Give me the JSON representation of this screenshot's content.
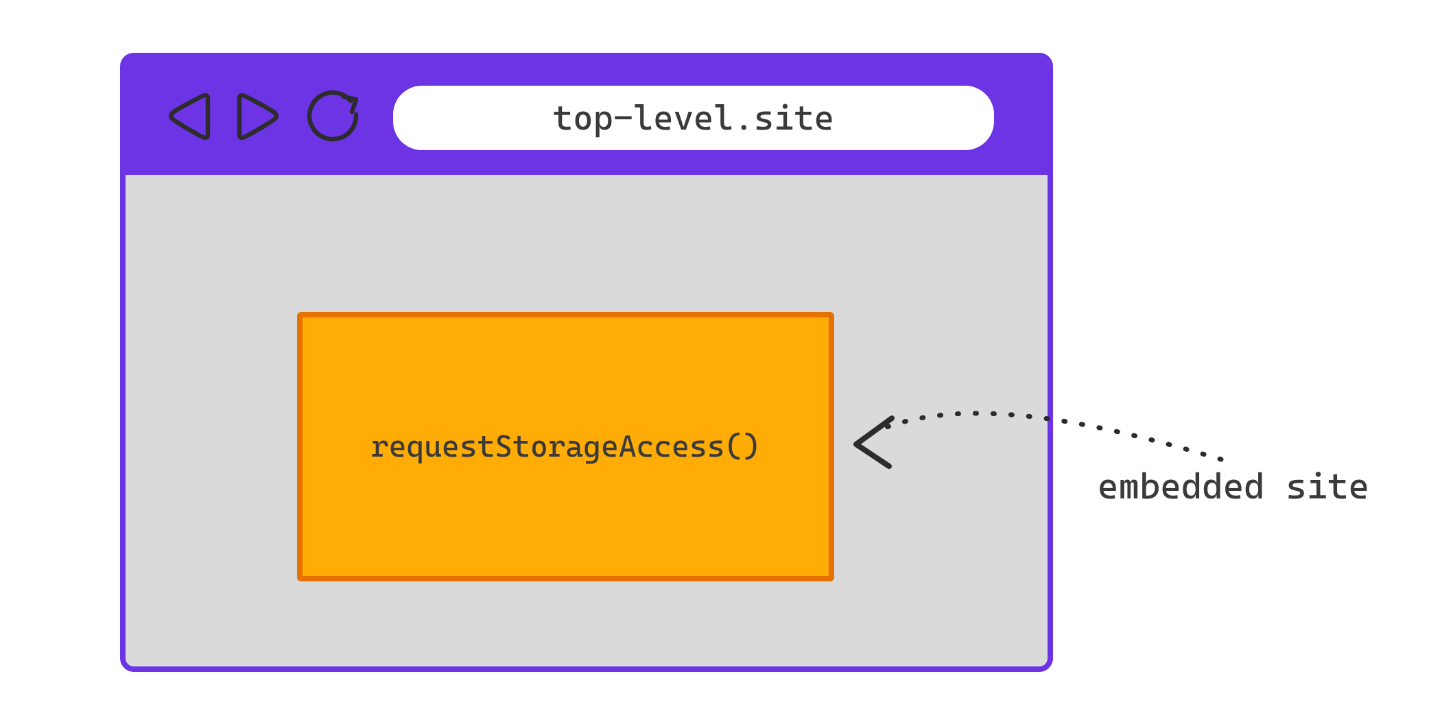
{
  "browser": {
    "address_url": "top-level.site",
    "icons": {
      "back": "back-icon",
      "forward": "forward-icon",
      "reload": "reload-icon"
    }
  },
  "iframe": {
    "code_text": "requestStorageAccess()"
  },
  "annotation": {
    "label": "embedded site"
  },
  "colors": {
    "accent_purple": "#6C34E4",
    "iframe_fill": "#FFAC07",
    "iframe_border": "#E57100",
    "page_bg": "#DADADA",
    "stroke_dark": "#3a3a3a"
  }
}
